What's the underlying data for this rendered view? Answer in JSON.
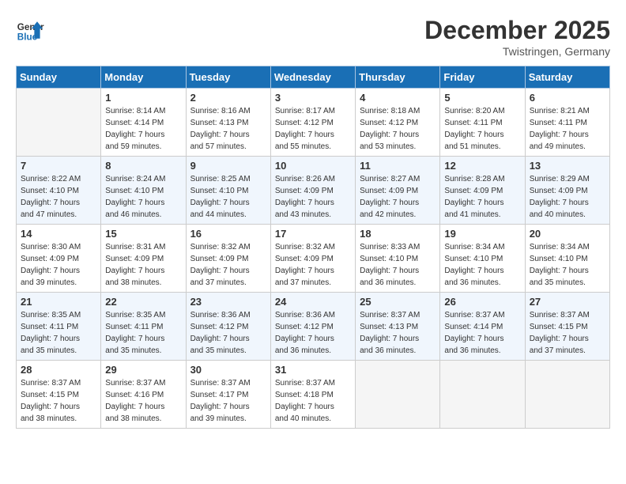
{
  "header": {
    "logo_line1": "General",
    "logo_line2": "Blue",
    "month": "December 2025",
    "location": "Twistringen, Germany"
  },
  "weekdays": [
    "Sunday",
    "Monday",
    "Tuesday",
    "Wednesday",
    "Thursday",
    "Friday",
    "Saturday"
  ],
  "weeks": [
    [
      {
        "num": "",
        "info": ""
      },
      {
        "num": "1",
        "info": "Sunrise: 8:14 AM\nSunset: 4:14 PM\nDaylight: 7 hours\nand 59 minutes."
      },
      {
        "num": "2",
        "info": "Sunrise: 8:16 AM\nSunset: 4:13 PM\nDaylight: 7 hours\nand 57 minutes."
      },
      {
        "num": "3",
        "info": "Sunrise: 8:17 AM\nSunset: 4:12 PM\nDaylight: 7 hours\nand 55 minutes."
      },
      {
        "num": "4",
        "info": "Sunrise: 8:18 AM\nSunset: 4:12 PM\nDaylight: 7 hours\nand 53 minutes."
      },
      {
        "num": "5",
        "info": "Sunrise: 8:20 AM\nSunset: 4:11 PM\nDaylight: 7 hours\nand 51 minutes."
      },
      {
        "num": "6",
        "info": "Sunrise: 8:21 AM\nSunset: 4:11 PM\nDaylight: 7 hours\nand 49 minutes."
      }
    ],
    [
      {
        "num": "7",
        "info": "Sunrise: 8:22 AM\nSunset: 4:10 PM\nDaylight: 7 hours\nand 47 minutes."
      },
      {
        "num": "8",
        "info": "Sunrise: 8:24 AM\nSunset: 4:10 PM\nDaylight: 7 hours\nand 46 minutes."
      },
      {
        "num": "9",
        "info": "Sunrise: 8:25 AM\nSunset: 4:10 PM\nDaylight: 7 hours\nand 44 minutes."
      },
      {
        "num": "10",
        "info": "Sunrise: 8:26 AM\nSunset: 4:09 PM\nDaylight: 7 hours\nand 43 minutes."
      },
      {
        "num": "11",
        "info": "Sunrise: 8:27 AM\nSunset: 4:09 PM\nDaylight: 7 hours\nand 42 minutes."
      },
      {
        "num": "12",
        "info": "Sunrise: 8:28 AM\nSunset: 4:09 PM\nDaylight: 7 hours\nand 41 minutes."
      },
      {
        "num": "13",
        "info": "Sunrise: 8:29 AM\nSunset: 4:09 PM\nDaylight: 7 hours\nand 40 minutes."
      }
    ],
    [
      {
        "num": "14",
        "info": "Sunrise: 8:30 AM\nSunset: 4:09 PM\nDaylight: 7 hours\nand 39 minutes."
      },
      {
        "num": "15",
        "info": "Sunrise: 8:31 AM\nSunset: 4:09 PM\nDaylight: 7 hours\nand 38 minutes."
      },
      {
        "num": "16",
        "info": "Sunrise: 8:32 AM\nSunset: 4:09 PM\nDaylight: 7 hours\nand 37 minutes."
      },
      {
        "num": "17",
        "info": "Sunrise: 8:32 AM\nSunset: 4:09 PM\nDaylight: 7 hours\nand 37 minutes."
      },
      {
        "num": "18",
        "info": "Sunrise: 8:33 AM\nSunset: 4:10 PM\nDaylight: 7 hours\nand 36 minutes."
      },
      {
        "num": "19",
        "info": "Sunrise: 8:34 AM\nSunset: 4:10 PM\nDaylight: 7 hours\nand 36 minutes."
      },
      {
        "num": "20",
        "info": "Sunrise: 8:34 AM\nSunset: 4:10 PM\nDaylight: 7 hours\nand 35 minutes."
      }
    ],
    [
      {
        "num": "21",
        "info": "Sunrise: 8:35 AM\nSunset: 4:11 PM\nDaylight: 7 hours\nand 35 minutes."
      },
      {
        "num": "22",
        "info": "Sunrise: 8:35 AM\nSunset: 4:11 PM\nDaylight: 7 hours\nand 35 minutes."
      },
      {
        "num": "23",
        "info": "Sunrise: 8:36 AM\nSunset: 4:12 PM\nDaylight: 7 hours\nand 35 minutes."
      },
      {
        "num": "24",
        "info": "Sunrise: 8:36 AM\nSunset: 4:12 PM\nDaylight: 7 hours\nand 36 minutes."
      },
      {
        "num": "25",
        "info": "Sunrise: 8:37 AM\nSunset: 4:13 PM\nDaylight: 7 hours\nand 36 minutes."
      },
      {
        "num": "26",
        "info": "Sunrise: 8:37 AM\nSunset: 4:14 PM\nDaylight: 7 hours\nand 36 minutes."
      },
      {
        "num": "27",
        "info": "Sunrise: 8:37 AM\nSunset: 4:15 PM\nDaylight: 7 hours\nand 37 minutes."
      }
    ],
    [
      {
        "num": "28",
        "info": "Sunrise: 8:37 AM\nSunset: 4:15 PM\nDaylight: 7 hours\nand 38 minutes."
      },
      {
        "num": "29",
        "info": "Sunrise: 8:37 AM\nSunset: 4:16 PM\nDaylight: 7 hours\nand 38 minutes."
      },
      {
        "num": "30",
        "info": "Sunrise: 8:37 AM\nSunset: 4:17 PM\nDaylight: 7 hours\nand 39 minutes."
      },
      {
        "num": "31",
        "info": "Sunrise: 8:37 AM\nSunset: 4:18 PM\nDaylight: 7 hours\nand 40 minutes."
      },
      {
        "num": "",
        "info": ""
      },
      {
        "num": "",
        "info": ""
      },
      {
        "num": "",
        "info": ""
      }
    ]
  ]
}
